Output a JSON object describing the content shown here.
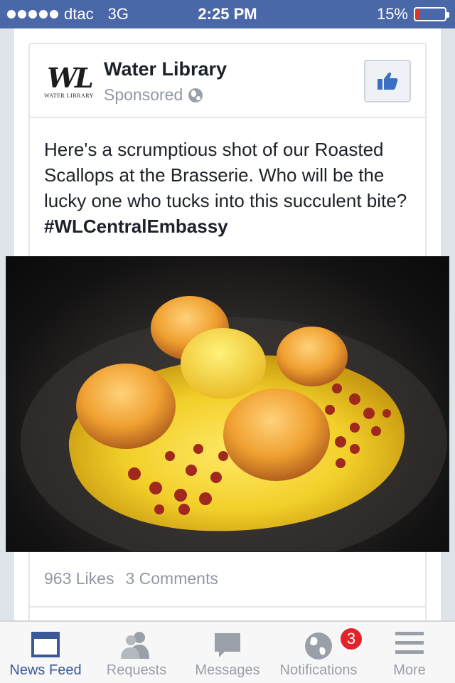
{
  "status_bar": {
    "carrier": "dtac",
    "network": "3G",
    "time": "2:25 PM",
    "battery_percent": "15%",
    "battery_level": 0.15,
    "signal_bars": 5
  },
  "post": {
    "page_name": "Water Library",
    "logo_mark": "WL",
    "logo_subtitle": "WATER LIBRARY",
    "sponsored_label": "Sponsored",
    "text_body": "Here's a scrumptious shot of our Roasted Scallops at the Brasserie. Who will be the lucky one who tucks into this succulent bite? ",
    "hashtag": "#WLCentralEmbassy",
    "likes": "963 Likes",
    "comments": "3 Comments"
  },
  "tab_bar": {
    "tabs": [
      {
        "label": "News Feed",
        "icon": "news-feed-icon",
        "active": true
      },
      {
        "label": "Requests",
        "icon": "requests-icon",
        "active": false
      },
      {
        "label": "Messages",
        "icon": "messages-icon",
        "active": false
      },
      {
        "label": "Notifications",
        "icon": "notifications-globe-icon",
        "active": false,
        "badge": "3"
      },
      {
        "label": "More",
        "icon": "more-menu-icon",
        "active": false
      }
    ]
  },
  "colors": {
    "facebook_blue": "#3b5998",
    "status_bar": "#4a67a7",
    "badge_red": "#e3232a",
    "battery_low": "#e0342b"
  }
}
